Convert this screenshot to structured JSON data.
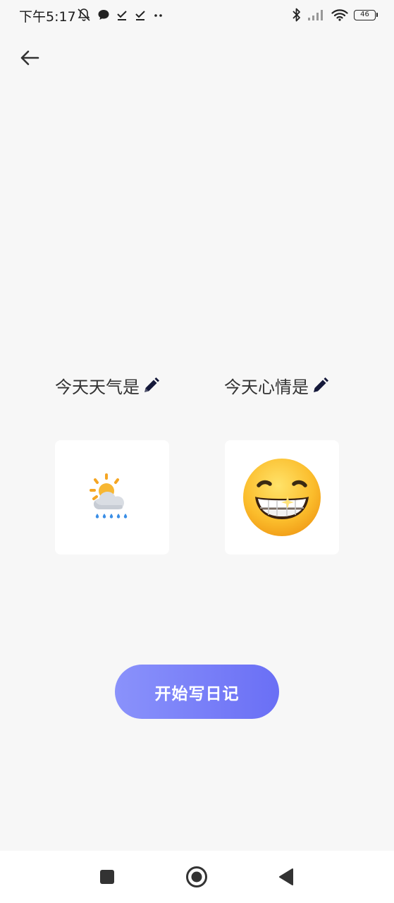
{
  "status_bar": {
    "time": "下午5:17",
    "battery_level": "46",
    "left_icons": [
      "mute-bell-icon",
      "chat-bubble-icon",
      "download-done-icon",
      "download-done-icon",
      "more-dots-icon"
    ],
    "right_icons": [
      "bluetooth-icon",
      "signal-icon",
      "wifi-icon",
      "battery-icon"
    ]
  },
  "header": {
    "back_icon": "arrow-left-icon"
  },
  "weather": {
    "label": "今天天气是",
    "edit_icon": "pencil-icon",
    "selected_icon": "sun-behind-rain-cloud-icon"
  },
  "mood": {
    "label": "今天心情是",
    "edit_icon": "pencil-icon",
    "selected_icon": "grinning-face-icon"
  },
  "cta": {
    "label": "开始写日记"
  },
  "nav_bar": {
    "items": [
      "recent-apps-icon",
      "home-icon",
      "back-icon"
    ]
  },
  "colors": {
    "background": "#f7f7f7",
    "card": "#ffffff",
    "cta_gradient_start": "#8a92fb",
    "cta_gradient_end": "#6a6ff5",
    "text": "#333333"
  }
}
